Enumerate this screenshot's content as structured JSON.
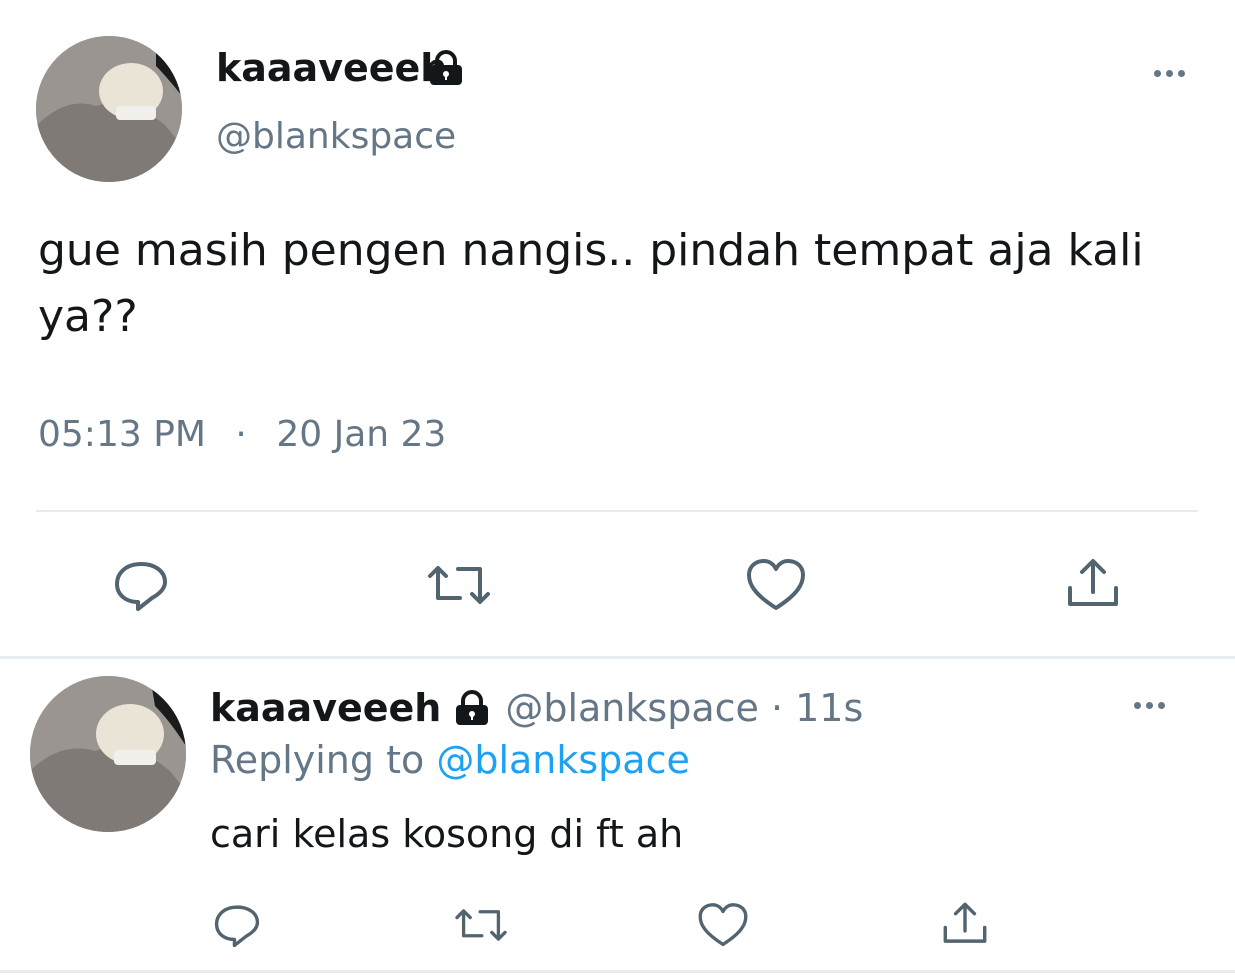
{
  "main_tweet": {
    "display_name": "kaaaveeeh",
    "handle": "@blankspace",
    "text": "gue masih pengen nangis.. pindah tempat aja kali ya??",
    "time": "05:13 PM",
    "separator": "·",
    "date": "20 Jan 23"
  },
  "reply_tweet": {
    "display_name": "kaaaveeeh",
    "handle_meta": "@blankspace · 11s",
    "replying_prefix": "Replying to",
    "replying_handle": "@blankspace",
    "text": "cari kelas kosong di ft ah"
  },
  "icons": [
    "lock-icon",
    "more-icon",
    "reply-icon",
    "retweet-icon",
    "like-icon",
    "share-icon"
  ],
  "colors": {
    "muted": "#657786",
    "link": "#1da1f2",
    "divider": "#e6ecf0",
    "icon": "#536471"
  }
}
